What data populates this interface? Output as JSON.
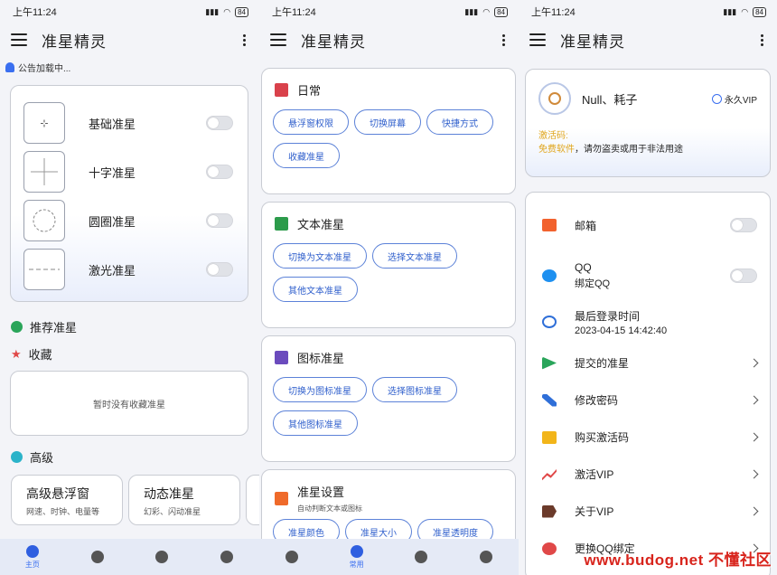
{
  "status": {
    "time": "上午11:24",
    "battery": "84"
  },
  "panel1": {
    "app_title": "准星精灵",
    "notice": "公告加载中...",
    "crosshairs": [
      {
        "label": "基础准星",
        "icon": "dot-crosshair-icon"
      },
      {
        "label": "十字准星",
        "icon": "cross-crosshair-icon"
      },
      {
        "label": "圆圈准星",
        "icon": "circle-crosshair-icon"
      },
      {
        "label": "激光准星",
        "icon": "laser-crosshair-icon"
      }
    ],
    "recommend": "推荐准星",
    "favorites": "收藏",
    "favorites_empty": "暂时没有收藏准星",
    "advanced": "高级",
    "adv_cards": [
      {
        "title": "高级悬浮窗",
        "sub": "网速、时钟、电量等"
      },
      {
        "title": "动态准星",
        "sub": "幻彩、闪动准星"
      }
    ]
  },
  "panel2": {
    "app_title": "准星精灵",
    "groups": [
      {
        "title": "日常",
        "sub": "",
        "color": "#d9414b",
        "chips": [
          "悬浮窗权限",
          "切换屏幕",
          "快捷方式",
          "收藏准星"
        ]
      },
      {
        "title": "文本准星",
        "sub": "",
        "color": "#2c9b4b",
        "chips": [
          "切换为文本准星",
          "选择文本准星",
          "其他文本准星"
        ]
      },
      {
        "title": "图标准星",
        "sub": "",
        "color": "#6b4bbd",
        "chips": [
          "切换为图标准星",
          "选择图标准星",
          "其他图标准星"
        ]
      },
      {
        "title": "准星设置",
        "sub": "自动判断文本或图标",
        "color": "#ef6a2a",
        "chips": [
          "准星颜色",
          "准星大小",
          "准星透明度"
        ]
      }
    ]
  },
  "panel3": {
    "app_title": "准星精灵",
    "username": "Null、耗子",
    "vip": "永久VIP",
    "activation_label": "激活码:",
    "activation_value": "免费软件",
    "activation_note": "，请勿盗卖或用于非法用途",
    "items": [
      {
        "label": "邮箱",
        "sub": "",
        "color": "#f2622e",
        "kind": "toggle"
      },
      {
        "label": "QQ",
        "sub": "绑定QQ",
        "color": "#1e90f0",
        "kind": "toggle"
      },
      {
        "label": "最后登录时间",
        "sub": "2023-04-15 14:42:40",
        "color": "#2f6fd8",
        "kind": "none"
      },
      {
        "label": "提交的准星",
        "sub": "",
        "color": "#2aa55a",
        "kind": "chevron"
      },
      {
        "label": "修改密码",
        "sub": "",
        "color": "#2f6fd8",
        "kind": "chevron"
      },
      {
        "label": "购买激活码",
        "sub": "",
        "color": "#f2b51a",
        "kind": "chevron"
      },
      {
        "label": "激活VIP",
        "sub": "",
        "color": "#e04848",
        "kind": "chevron"
      },
      {
        "label": "关于VIP",
        "sub": "",
        "color": "#6b3a2a",
        "kind": "chevron"
      },
      {
        "label": "更换QQ绑定",
        "sub": "",
        "color": "#e04848",
        "kind": "chevron"
      }
    ]
  },
  "bottom_nav": [
    {
      "label": "主页",
      "icon": "home-icon"
    },
    {
      "label": "",
      "icon": "palette-icon"
    },
    {
      "label": "",
      "icon": "gear-icon"
    },
    {
      "label": "",
      "icon": "person-icon"
    }
  ],
  "bottom_nav_p2": [
    {
      "label": "",
      "icon": "home-icon"
    },
    {
      "label": "常用",
      "icon": "palette-icon"
    },
    {
      "label": "",
      "icon": "gear-icon"
    },
    {
      "label": "",
      "icon": "person-icon"
    }
  ],
  "watermark": "www.budog.net 不懂社区"
}
